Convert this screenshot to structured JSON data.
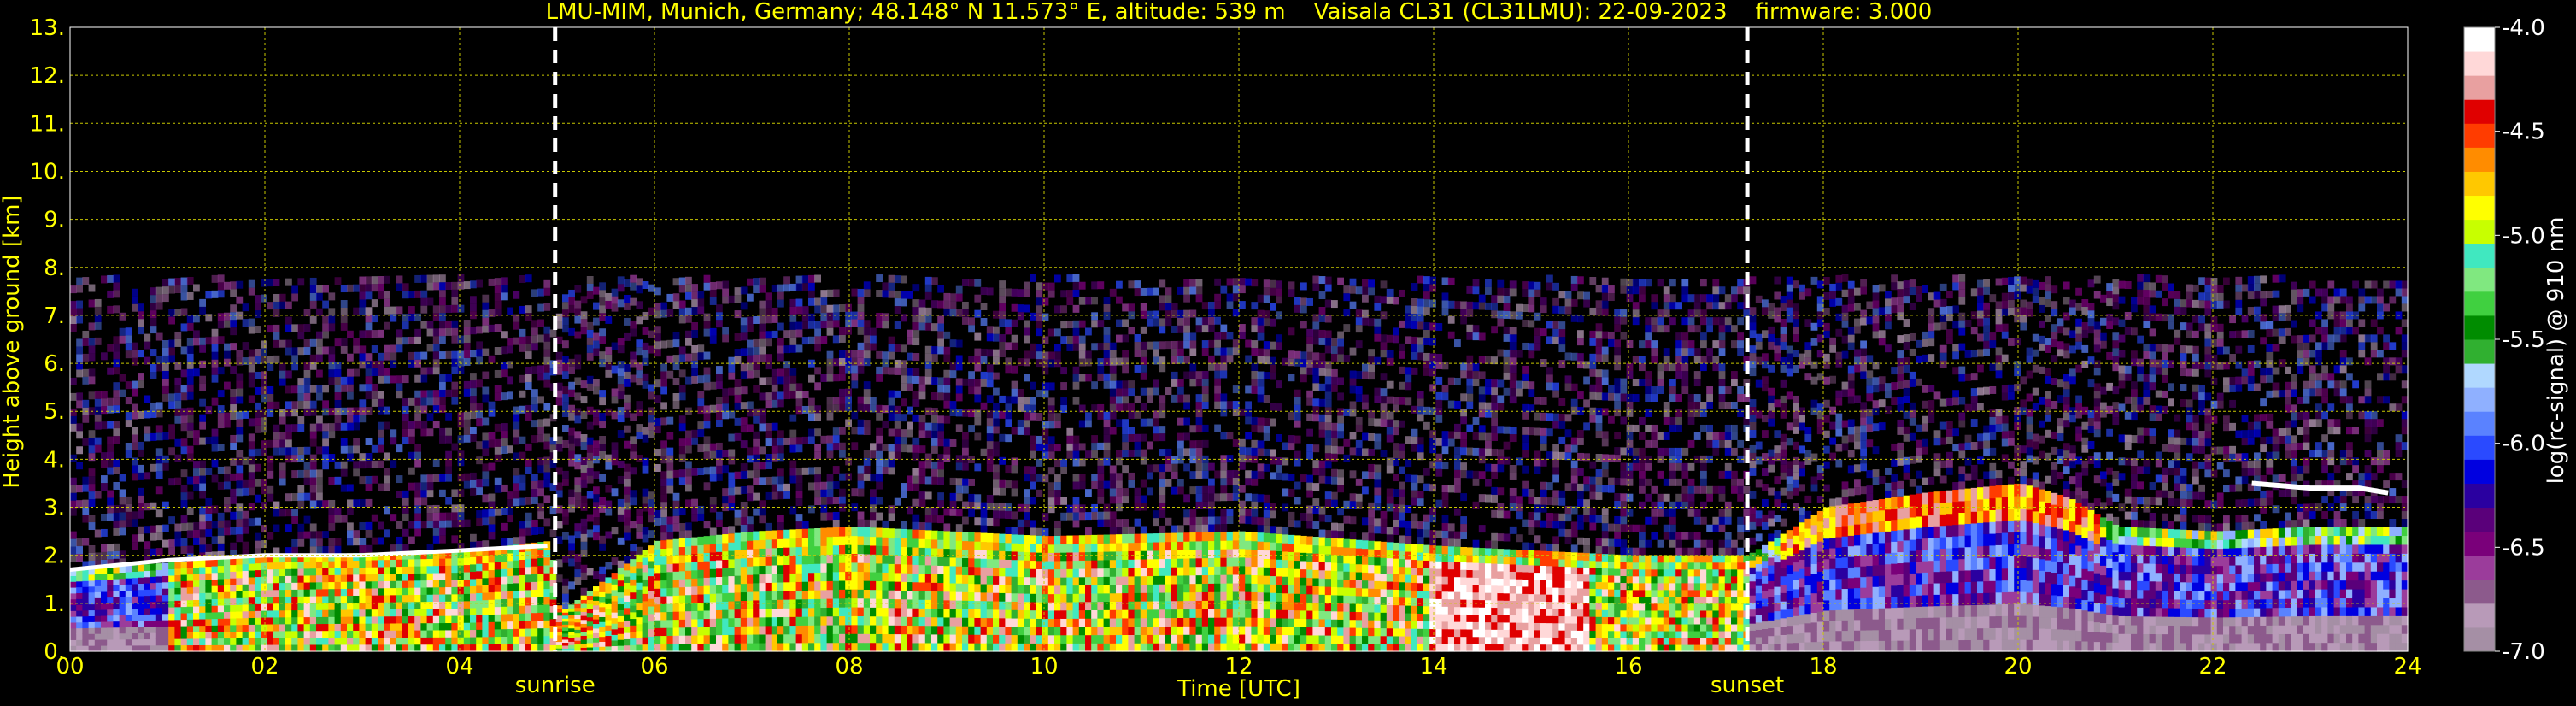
{
  "title": "LMU-MIM, Munich, Germany; 48.148° N 11.573° E, altitude: 539 m    Vaisala CL31 (CL31LMU): 22-09-2023    firmware: 3.000",
  "colors": {
    "background": "#000000",
    "axis_text": "#ffff00",
    "grid": "#c8c800",
    "colorbar_text": "#ffffff",
    "marker_line": "#ffffff"
  },
  "chart_data": {
    "type": "heatmap",
    "title": "LMU-MIM, Munich, Germany; 48.148° N 11.573° E, altitude: 539 m    Vaisala CL31 (CL31LMU): 22-09-2023    firmware: 3.000",
    "xlabel": "Time [UTC]",
    "ylabel": "Height above ground [km]",
    "xlim": [
      0,
      24
    ],
    "ylim": [
      0,
      13
    ],
    "x_ticks": [
      "00",
      "02",
      "04",
      "06",
      "08",
      "10",
      "12",
      "14",
      "16",
      "18",
      "20",
      "22",
      "24"
    ],
    "y_ticks": [
      "0.",
      "1.",
      "2.",
      "3.",
      "4.",
      "5.",
      "6.",
      "7.",
      "8.",
      "9.",
      "10.",
      "11.",
      "12.",
      "13."
    ],
    "grid": true,
    "vertical_markers": [
      {
        "label": "sunrise",
        "time_utc": 4.98
      },
      {
        "label": "sunset",
        "time_utc": 17.22
      }
    ],
    "signal_ceiling_km": 7.7,
    "colorbar": {
      "label": "log(rc-signal) @ 910 nm",
      "range": [
        -7.0,
        -4.0
      ],
      "ticks": [
        "-4.0",
        "-4.5",
        "-5.0",
        "-5.5",
        "-6.0",
        "-6.5",
        "-7.0"
      ],
      "colors": [
        "#a58fa5",
        "#b89ab8",
        "#8c5a8c",
        "#9b3c9b",
        "#7a007a",
        "#5a007a",
        "#2a00a0",
        "#0000e0",
        "#2a4aff",
        "#5a82ff",
        "#8fb0ff",
        "#b0d8ff",
        "#30b030",
        "#008c00",
        "#40d040",
        "#80e880",
        "#40e8c0",
        "#c8ff00",
        "#ffff00",
        "#ffc800",
        "#ff8c00",
        "#ff3c00",
        "#e00000",
        "#e8a0a0",
        "#ffd8d8",
        "#ffffff"
      ]
    },
    "layers": [
      {
        "name": "boundary_layer_top_km",
        "x": [
          0,
          2,
          4,
          4.9,
          5.0,
          6,
          7,
          8,
          10,
          12,
          14,
          16,
          17.2,
          18,
          19,
          20,
          20.5,
          21,
          22,
          23,
          24
        ],
        "y": [
          1.7,
          2.0,
          2.1,
          2.3,
          0.8,
          2.3,
          2.5,
          2.6,
          2.4,
          2.5,
          2.2,
          2.0,
          2.0,
          3.0,
          3.3,
          3.5,
          3.2,
          2.6,
          2.5,
          2.6,
          2.6
        ]
      },
      {
        "name": "cloud_layer_km",
        "x": [
          0,
          1,
          2,
          3,
          4,
          4.9
        ],
        "y": [
          1.7,
          1.9,
          2.0,
          2.0,
          2.1,
          2.2
        ]
      },
      {
        "name": "elevated_layer_km",
        "x": [
          22.4,
          23,
          23.5,
          23.8
        ],
        "y": [
          3.5,
          3.4,
          3.4,
          3.3
        ]
      }
    ]
  }
}
